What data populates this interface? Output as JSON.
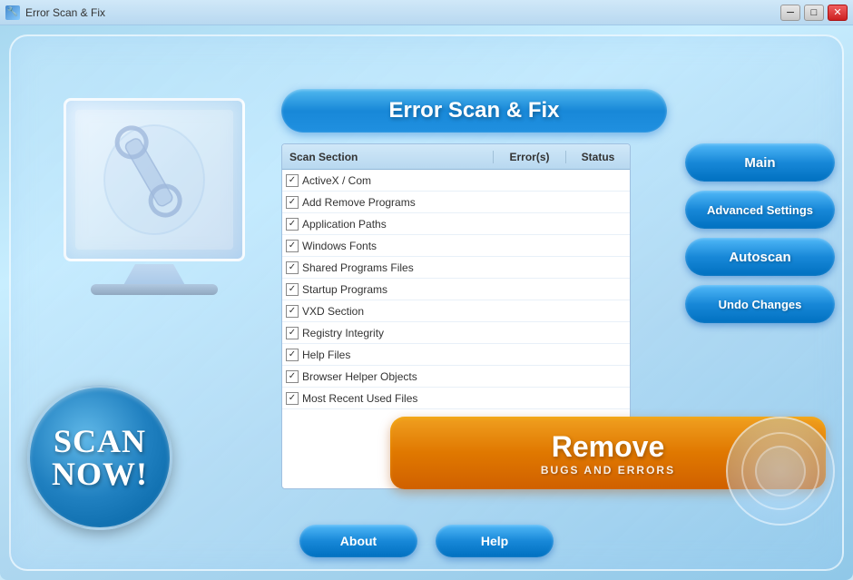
{
  "window": {
    "title": "Error Scan & Fix",
    "icon": "🔧"
  },
  "title_buttons": {
    "minimize": "─",
    "maximize": "□",
    "close": "✕"
  },
  "app_title": "Error Scan & Fix",
  "scan_table": {
    "columns": {
      "section": "Scan Section",
      "errors": "Error(s)",
      "status": "Status"
    },
    "rows": [
      {
        "label": "ActiveX / Com",
        "checked": true,
        "errors": "",
        "status": ""
      },
      {
        "label": "Add Remove Programs",
        "checked": true,
        "errors": "",
        "status": ""
      },
      {
        "label": "Application Paths",
        "checked": true,
        "errors": "",
        "status": ""
      },
      {
        "label": "Windows Fonts",
        "checked": true,
        "errors": "",
        "status": ""
      },
      {
        "label": "Shared Programs Files",
        "checked": true,
        "errors": "",
        "status": ""
      },
      {
        "label": "Startup Programs",
        "checked": true,
        "errors": "",
        "status": ""
      },
      {
        "label": "VXD Section",
        "checked": true,
        "errors": "",
        "status": ""
      },
      {
        "label": "Registry Integrity",
        "checked": true,
        "errors": "",
        "status": ""
      },
      {
        "label": "Help Files",
        "checked": true,
        "errors": "",
        "status": ""
      },
      {
        "label": "Browser Helper Objects",
        "checked": true,
        "errors": "",
        "status": ""
      },
      {
        "label": "Most Recent Used Files",
        "checked": true,
        "errors": "",
        "status": ""
      }
    ]
  },
  "nav_buttons": {
    "main": "Main",
    "advanced_settings": "Advanced Settings",
    "autoscan": "Autoscan",
    "undo_changes": "Undo Changes"
  },
  "scan_now": {
    "line1": "Scan",
    "line2": "Now!"
  },
  "remove_button": {
    "main": "Remove",
    "sub": "BUGS AND ERRORS"
  },
  "bottom_buttons": {
    "about": "About",
    "help": "Help"
  }
}
